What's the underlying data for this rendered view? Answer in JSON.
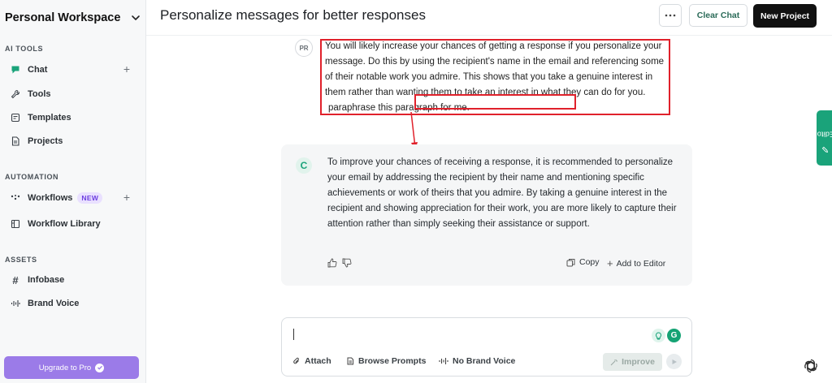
{
  "sidebar": {
    "workspace_title": "Personal Workspace",
    "sections": {
      "ai_tools": "AI TOOLS",
      "automation": "AUTOMATION",
      "assets": "ASSETS"
    },
    "items": [
      {
        "label": "Chat",
        "icon": "chat-bubble-icon"
      },
      {
        "label": "Tools",
        "icon": "wrench-icon"
      },
      {
        "label": "Templates",
        "icon": "template-icon"
      },
      {
        "label": "Projects",
        "icon": "document-icon"
      },
      {
        "label": "Workflows",
        "icon": "workflow-dots-icon",
        "badge": "NEW"
      },
      {
        "label": "Workflow Library",
        "icon": "library-icon"
      },
      {
        "label": "Infobase",
        "icon": "hash-icon"
      },
      {
        "label": "Brand Voice",
        "icon": "waveform-icon"
      }
    ],
    "upgrade_label": "Upgrade to Pro"
  },
  "topbar": {
    "title": "Personalize messages for better responses",
    "clear_label": "Clear Chat",
    "new_project_label": "New Project"
  },
  "user_message": {
    "avatar": "PR",
    "text_main": "You will likely increase your chances of getting a response if you personalize your message. Do this by using the recipient's name in the email and referencing some of their notable work you admire. This shows that you take a genuine interest in them rather than wanting them to take an interest in what they can do for you.",
    "text_prompt": "paraphrase this paragraph for me."
  },
  "ai_message": {
    "avatar": "C",
    "text": "To improve your chances of receiving a response, it is recommended to personalize your email by addressing the recipient by their name and mentioning specific achievements or work of theirs that you admire. By taking a genuine interest in the recipient and showing appreciation for their work, you are more likely to capture their attention rather than simply seeking their assistance or support.",
    "copy_label": "Copy",
    "add_to_editor_label": "Add to Editor"
  },
  "editor_tab_label": "Editor",
  "composer": {
    "input_value": "",
    "attach_label": "Attach",
    "browse_prompts_label": "Browse Prompts",
    "brand_voice_label": "No Brand Voice",
    "improve_label": "Improve",
    "g_label": "G"
  },
  "colors": {
    "accent_green": "#1aa37a",
    "annotation_red": "#e0212b",
    "upgrade_purple": "#9b7be8"
  }
}
